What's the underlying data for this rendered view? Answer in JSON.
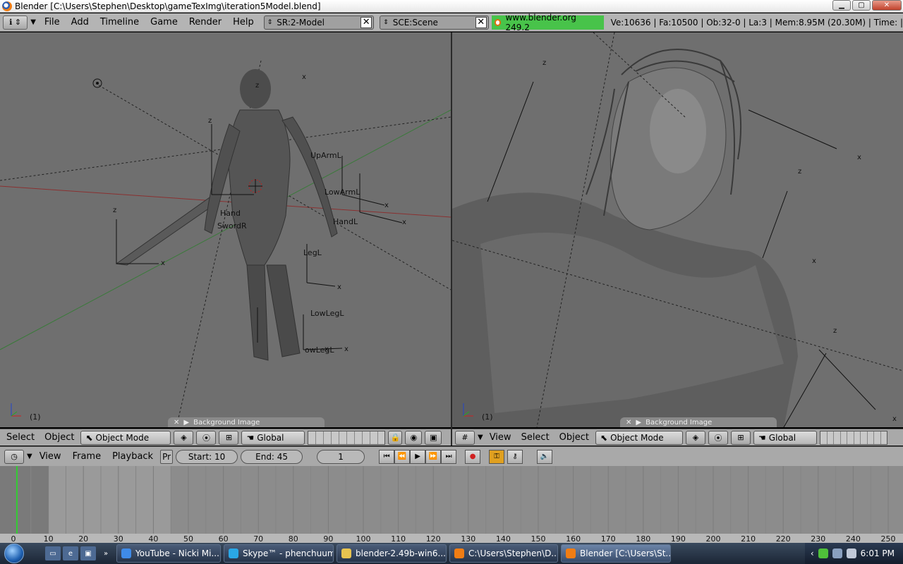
{
  "window": {
    "title": "Blender [C:\\Users\\Stephen\\Desktop\\gameTexImg\\iteration5Model.blend]",
    "buttons": [
      "minimize",
      "maximize",
      "close"
    ]
  },
  "info_header": {
    "menus": [
      "File",
      "Add",
      "Timeline",
      "Game",
      "Render",
      "Help"
    ],
    "screen_field": "SR:2-Model",
    "scene_field": "SCE:Scene",
    "website": "www.blender.org 249.2",
    "stats": "Ve:10636 | Fa:10500 | Ob:32-0 | La:3  | Mem:8.95M (20.30M)  | Time: |"
  },
  "left_view": {
    "frame_label": "(1)",
    "bg_image_label": "Background Image",
    "bone_labels": [
      "UpArmL",
      "LowArmL",
      "HandL",
      "Hand",
      "SwordR",
      "LegL",
      "LowLegL",
      "owLegL"
    ],
    "header": {
      "menus": [
        "Select",
        "Object"
      ],
      "mode": "Object Mode",
      "orientation": "Global"
    }
  },
  "right_view": {
    "frame_label": "(1)",
    "bg_image_label": "Background Image",
    "header": {
      "menus": [
        "View",
        "Select",
        "Object"
      ],
      "mode": "Object Mode",
      "orientation": "Global"
    }
  },
  "timeline": {
    "menus": [
      "View",
      "Frame",
      "Playback"
    ],
    "pr_label": "Pr",
    "start": "Start: 10",
    "end": "End: 45",
    "current_frame": "1",
    "ruler_ticks": [
      "0",
      "10",
      "20",
      "30",
      "40",
      "50",
      "60",
      "70",
      "80",
      "90",
      "100",
      "110",
      "120",
      "130",
      "140",
      "150",
      "160",
      "170",
      "180",
      "190",
      "200",
      "210",
      "220",
      "230",
      "240",
      "250"
    ],
    "start_value": 10,
    "end_value": 45,
    "current_value": 1
  },
  "taskbar": {
    "tasks": [
      {
        "label": "YouTube - Nicki Mi...",
        "icon_color": "#3f8be8"
      },
      {
        "label": "Skype™ - phenchuum",
        "icon_color": "#2aa7e6"
      },
      {
        "label": "blender-2.49b-win6...",
        "icon_color": "#e8c450"
      },
      {
        "label": "C:\\Users\\Stephen\\D...",
        "icon_color": "#f07d14"
      },
      {
        "label": "Blender [C:\\Users\\St...",
        "icon_color": "#f07d14",
        "active": true
      }
    ],
    "clock": "6:01 PM"
  },
  "colors": {
    "viewport_bg": "#6f6f6f",
    "header_bg": "#a9a9a9",
    "website_green": "#48c34a",
    "timeline_bg": "#8c8c8c",
    "frame_marker": "#33cc33"
  }
}
